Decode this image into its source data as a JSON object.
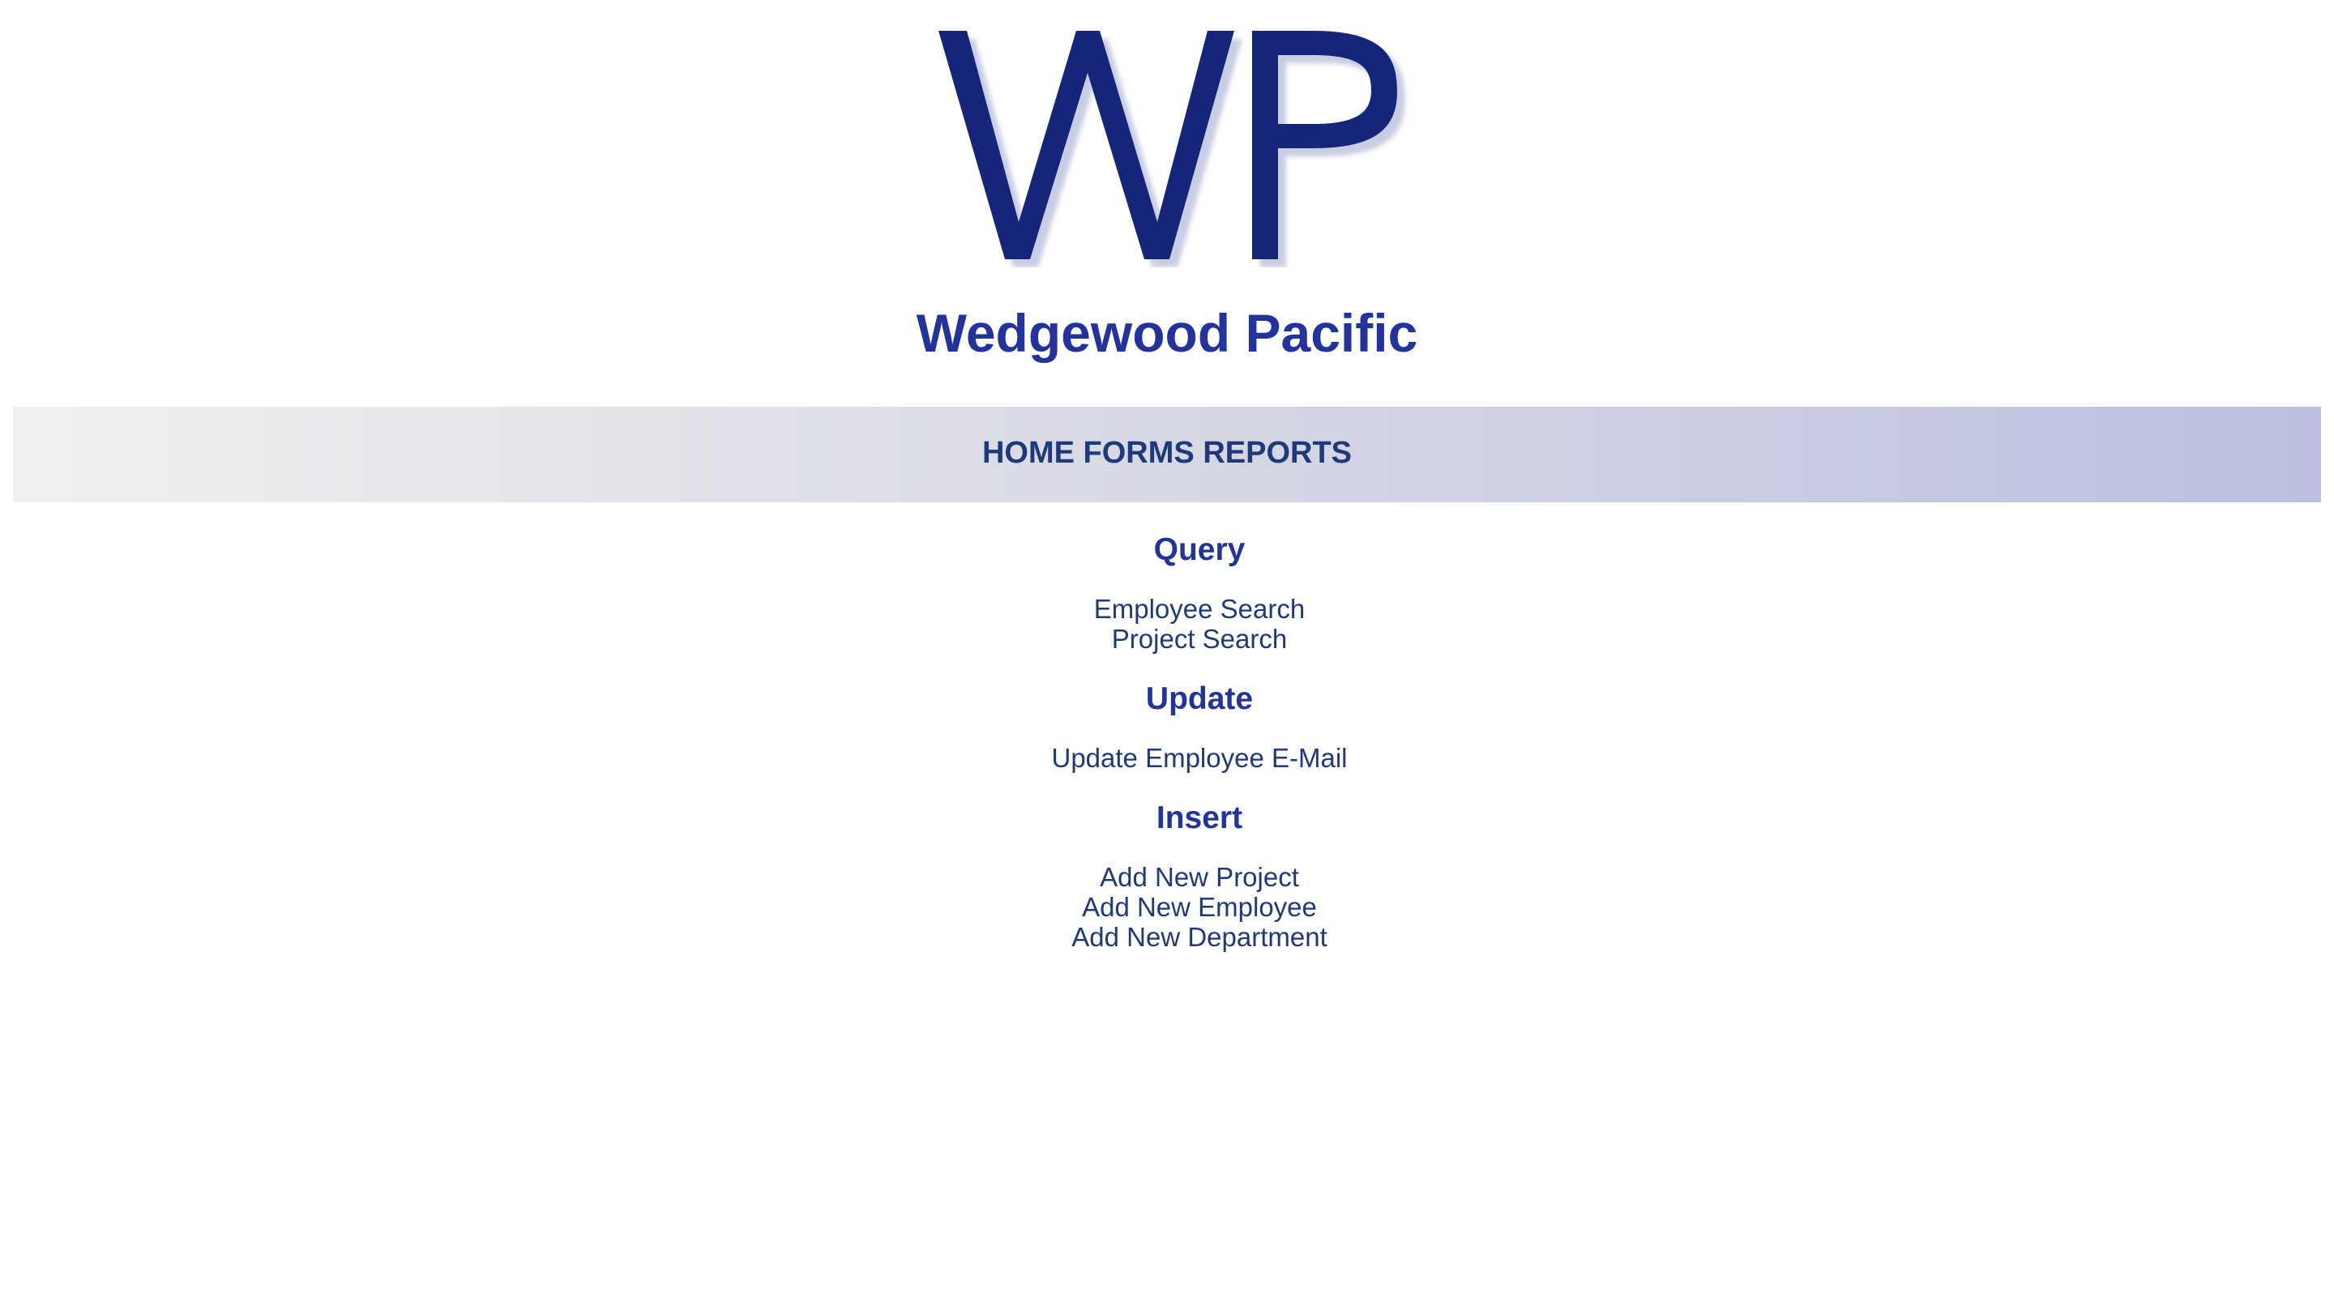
{
  "logo": {
    "text": "WP",
    "color": "#14257a",
    "shadow_color": "#d4d7ea"
  },
  "company": {
    "name": "Wedgewood Pacific"
  },
  "nav": {
    "home": "HOME",
    "forms": "FORMS",
    "reports": "REPORTS"
  },
  "sections": {
    "query": {
      "heading": "Query",
      "links": [
        "Employee Search",
        "Project Search"
      ]
    },
    "update": {
      "heading": "Update",
      "links": [
        "Update Employee E-Mail"
      ]
    },
    "insert": {
      "heading": "Insert",
      "links": [
        "Add New Project",
        "Add New Employee",
        "Add New Department"
      ]
    }
  },
  "colors": {
    "heading": "#22349b",
    "link": "#1e3a7a",
    "nav_gradient_start": "#f0f0f0",
    "nav_gradient_end": "#bcc0de"
  }
}
